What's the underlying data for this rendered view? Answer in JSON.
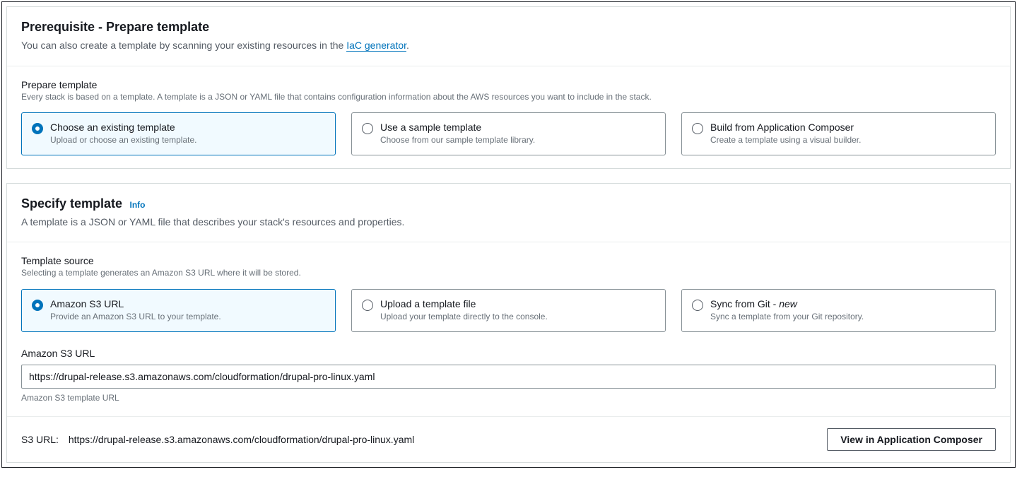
{
  "prerequisite": {
    "title": "Prerequisite - Prepare template",
    "desc_prefix": "You can also create a template by scanning your existing resources in the ",
    "link_text": "IaC generator",
    "desc_suffix": ".",
    "prepare_label": "Prepare template",
    "prepare_hint": "Every stack is based on a template. A template is a JSON or YAML file that contains configuration information about the AWS resources you want to include in the stack.",
    "options": [
      {
        "title": "Choose an existing template",
        "sub": "Upload or choose an existing template."
      },
      {
        "title": "Use a sample template",
        "sub": "Choose from our sample template library."
      },
      {
        "title": "Build from Application Composer",
        "sub": "Create a template using a visual builder."
      }
    ]
  },
  "specify": {
    "title": "Specify template",
    "info": "Info",
    "desc": "A template is a JSON or YAML file that describes your stack's resources and properties.",
    "source_label": "Template source",
    "source_hint": "Selecting a template generates an Amazon S3 URL where it will be stored.",
    "options": [
      {
        "title": "Amazon S3 URL",
        "sub": "Provide an Amazon S3 URL to your template."
      },
      {
        "title": "Upload a template file",
        "sub": "Upload your template directly to the console."
      },
      {
        "title_prefix": "Sync from Git - ",
        "title_suffix": "new",
        "sub": "Sync a template from your Git repository."
      }
    ],
    "url_label": "Amazon S3 URL",
    "url_value": "https://drupal-release.s3.amazonaws.com/cloudformation/drupal-pro-linux.yaml",
    "url_hint": "Amazon S3 template URL",
    "footer_label": "S3 URL:",
    "footer_value": "https://drupal-release.s3.amazonaws.com/cloudformation/drupal-pro-linux.yaml",
    "button": "View in Application Composer"
  }
}
